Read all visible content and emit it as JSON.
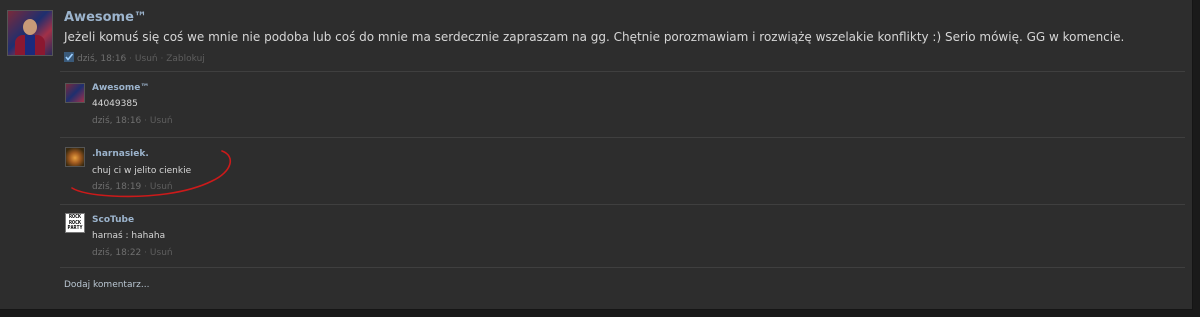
{
  "post": {
    "author": "Awesome™",
    "text": "Jeżeli komuś się coś we mnie nie podoba lub coś do mnie ma serdecznie zapraszam na gg. Chętnie porozmawiam i rozwiążę wszelakie konflikty :) Serio mówię. GG w komencie.",
    "time": "dziś, 18:16",
    "delete_label": "Usuń",
    "block_label": "Zablokuj",
    "separator": "·"
  },
  "comments": [
    {
      "author": "Awesome™",
      "text": "44049385",
      "time": "dziś, 18:16",
      "delete_label": "Usuń"
    },
    {
      "author": ".harnasiek.",
      "text": "chuj ci w jelito cienkie",
      "time": "dziś, 18:19",
      "delete_label": "Usuń"
    },
    {
      "author": "ScoTube",
      "text": "harnaś : hahaha",
      "time": "dziś, 18:22",
      "delete_label": "Usuń"
    }
  ],
  "scotube_avatar_text": [
    "ROCK",
    "ROCK",
    "PARTY"
  ],
  "add_comment_label": "Dodaj komentarz...",
  "colors": {
    "background": "#2d2d2d",
    "author": "#9cb4cd",
    "text": "#d6d6d6",
    "meta": "#6f6f6f",
    "annotation": "#cc1a1a"
  }
}
